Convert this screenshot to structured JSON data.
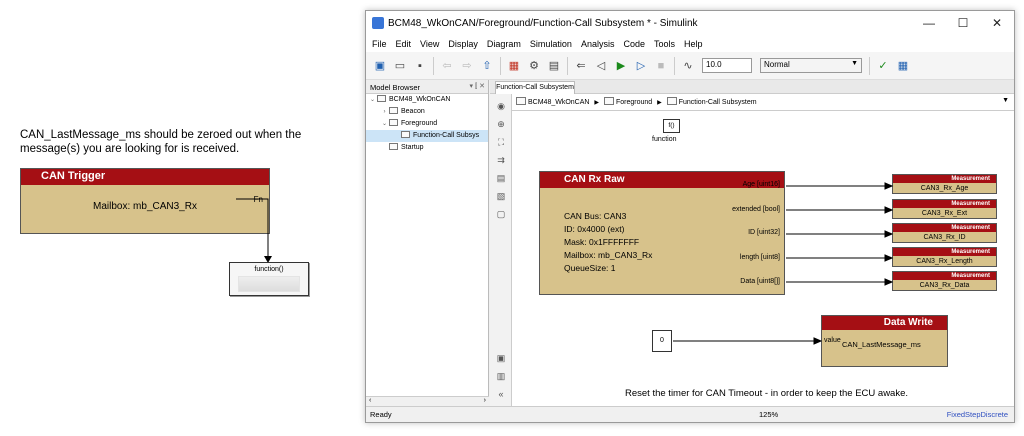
{
  "left_canvas": {
    "note_line1": "CAN_LastMessage_ms should be zeroed out when the",
    "note_line2": "message(s) you are looking for is received.",
    "trigger_block": {
      "title": "CAN Trigger",
      "body": "Mailbox: mb_CAN3_Rx",
      "port": "Fn"
    },
    "function_block": {
      "label": "function()"
    }
  },
  "window": {
    "title": "BCM48_WkOnCAN/Foreground/Function-Call Subsystem * - Simulink",
    "controls": {
      "minimize": "—",
      "maximize": "☐",
      "close": "✕"
    },
    "menu": [
      "File",
      "Edit",
      "View",
      "Display",
      "Diagram",
      "Simulation",
      "Analysis",
      "Code",
      "Tools",
      "Help"
    ],
    "toolbar": {
      "stop_time": "10.0",
      "sim_mode": "Normal"
    },
    "model_browser": {
      "title": "Model Browser",
      "items": [
        {
          "label": "BCM48_WkOnCAN",
          "caret": "⌄"
        },
        {
          "label": "Beacon",
          "caret": "›"
        },
        {
          "label": "Foreground",
          "caret": "⌄"
        },
        {
          "label": "Function-Call Subsys",
          "caret": ""
        },
        {
          "label": "Startup",
          "caret": ""
        }
      ]
    },
    "tab": "Function-Call Subsystem",
    "breadcrumb": [
      "BCM48_WkOnCAN",
      "Foreground",
      "Function-Call Subsystem"
    ],
    "canvas": {
      "function_block": {
        "symbol": "f()",
        "label": "function"
      },
      "rx_block": {
        "title": "CAN Rx Raw",
        "lines": [
          "CAN Bus: CAN3",
          "ID: 0x4000 (ext)",
          "Mask: 0x1FFFFFFF",
          "Mailbox: mb_CAN3_Rx",
          "QueueSize: 1"
        ],
        "ports": [
          "Age [uint16]",
          "extended [bool]",
          "ID [uint32]",
          "length [uint8]",
          "Data [uint8[]]"
        ]
      },
      "measurements": [
        {
          "head": "Measurement",
          "name": "CAN3_Rx_Age"
        },
        {
          "head": "Measurement",
          "name": "CAN3_Rx_Ext"
        },
        {
          "head": "Measurement",
          "name": "CAN3_Rx_ID"
        },
        {
          "head": "Measurement",
          "name": "CAN3_Rx_Length"
        },
        {
          "head": "Measurement",
          "name": "CAN3_Rx_Data"
        }
      ],
      "constant": "0",
      "data_write": {
        "title": "Data Write",
        "input": "value",
        "name": "CAN_LastMessage_ms"
      },
      "note": "Reset the timer for CAN Timeout - in order to keep the ECU awake."
    },
    "status": {
      "ready": "Ready",
      "zoom": "125%",
      "solver": "FixedStepDiscrete"
    }
  },
  "colors": {
    "block_fill": "#d7c28b",
    "block_header": "#a50f14"
  }
}
